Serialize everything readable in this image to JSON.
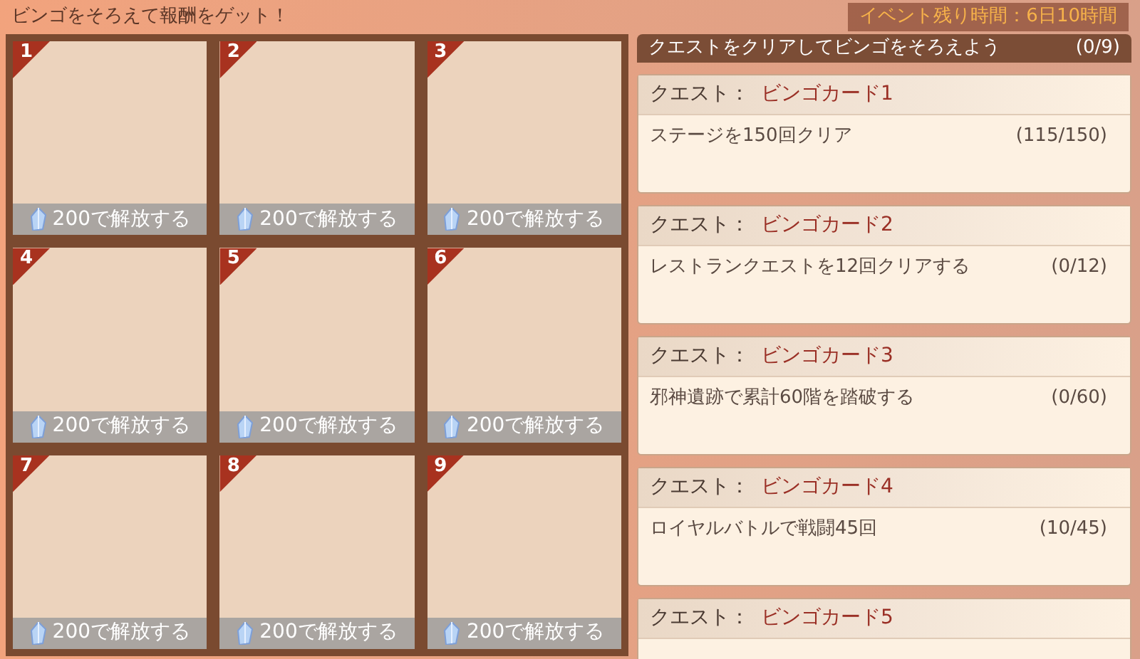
{
  "header": {
    "title": "ビンゴをそろえて報酬をゲット！",
    "timer": "イベント残り時間：6日10時間"
  },
  "bingo_cells": [
    {
      "number": "1",
      "unlock": "200で解放する"
    },
    {
      "number": "2",
      "unlock": "200で解放する"
    },
    {
      "number": "3",
      "unlock": "200で解放する"
    },
    {
      "number": "4",
      "unlock": "200で解放する"
    },
    {
      "number": "5",
      "unlock": "200で解放する"
    },
    {
      "number": "6",
      "unlock": "200で解放する"
    },
    {
      "number": "7",
      "unlock": "200で解放する"
    },
    {
      "number": "8",
      "unlock": "200で解放する"
    },
    {
      "number": "9",
      "unlock": "200で解放する"
    }
  ],
  "quest_panel": {
    "title": "クエストをクリアしてビンゴをそろえよう",
    "count": "(0/9)",
    "quests": [
      {
        "label": "クエスト：",
        "name": "ビンゴカード1",
        "task": "ステージを150回クリア",
        "tally": "(115/150)"
      },
      {
        "label": "クエスト：",
        "name": "ビンゴカード2",
        "task": "レストランクエストを12回クリアする",
        "tally": "(0/12)"
      },
      {
        "label": "クエスト：",
        "name": "ビンゴカード3",
        "task": "邪神遺跡で累計60階を踏破する",
        "tally": "(0/60)"
      },
      {
        "label": "クエスト：",
        "name": "ビンゴカード4",
        "task": "ロイヤルバトルで戦闘45回",
        "tally": "(10/45)"
      },
      {
        "label": "クエスト：",
        "name": "ビンゴカード5"
      }
    ]
  }
}
